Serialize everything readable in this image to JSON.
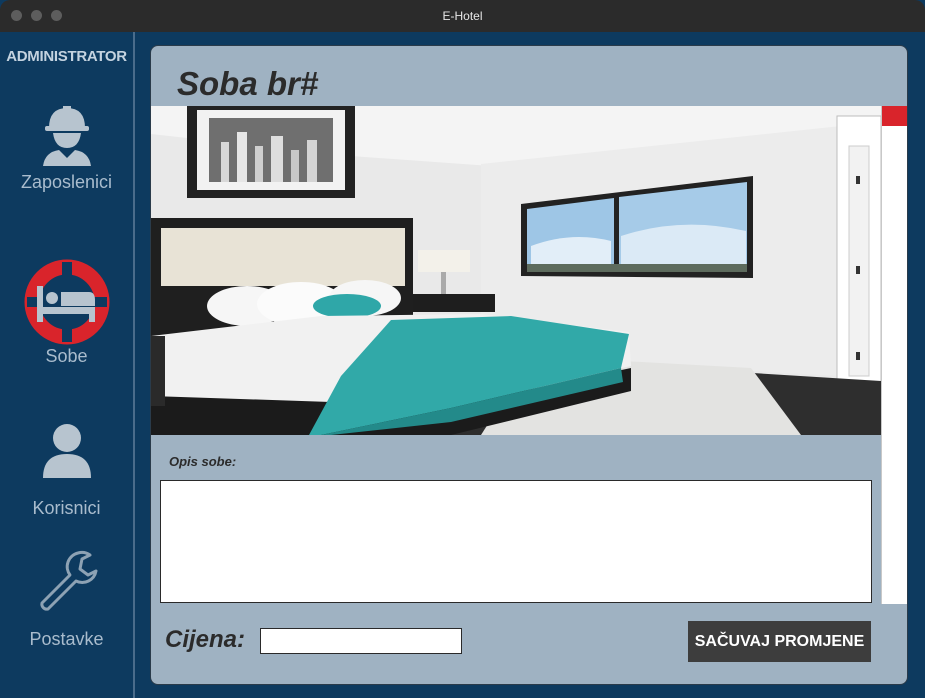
{
  "window": {
    "title": "E-Hotel"
  },
  "sidebar": {
    "header": "ADMINISTRATOR",
    "items": [
      {
        "label": "Zaposlenici",
        "icon": "worker-icon",
        "active": false
      },
      {
        "label": "Sobe",
        "icon": "bed-icon",
        "active": true
      },
      {
        "label": "Korisnici",
        "icon": "user-icon",
        "active": false
      },
      {
        "label": "Postavke",
        "icon": "wrench-icon",
        "active": false
      }
    ]
  },
  "main": {
    "title": "Soba br#",
    "description_label": "Opis sobe:",
    "description_value": "",
    "price_label": "Cijena:",
    "price_value": "",
    "save_label": "SAČUVAJ PROMJENE"
  },
  "colors": {
    "sidebar_bg": "#0d3a5f",
    "panel_bg": "#9fb2c2",
    "accent_red": "#d9242b",
    "button_bg": "#3d3d3d",
    "icon_gray": "#b7c4cf"
  }
}
